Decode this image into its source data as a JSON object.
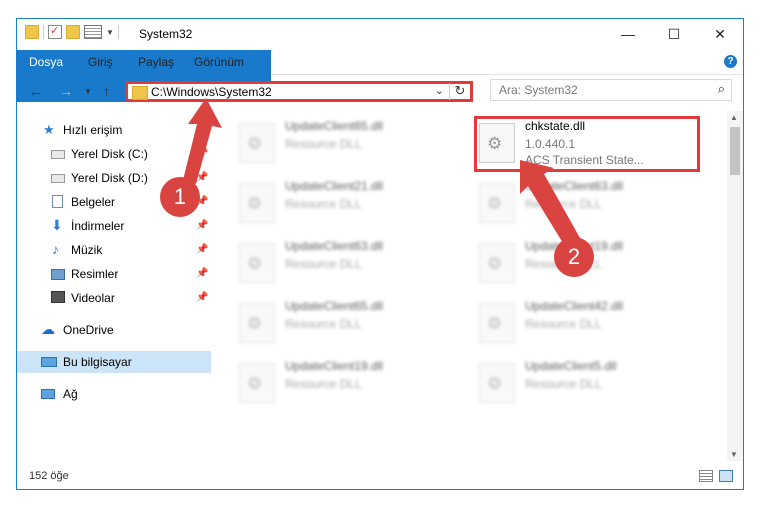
{
  "window": {
    "title": "System32"
  },
  "ribbon": {
    "tabs": [
      "Dosya",
      "Giriş",
      "Paylaş",
      "Görünüm"
    ]
  },
  "address": {
    "path": "C:\\Windows\\System32"
  },
  "search": {
    "placeholder": "Ara: System32"
  },
  "sidebar": {
    "quick_access": "Hızlı erişim",
    "items": [
      "Yerel Disk (C:)",
      "Yerel Disk (D:)",
      "Belgeler",
      "İndirmeler",
      "Müzik",
      "Resimler",
      "Videolar"
    ],
    "onedrive": "OneDrive",
    "this_pc": "Bu bilgisayar",
    "network": "Ağ"
  },
  "files": {
    "left": [
      {
        "name": "UpdateClient65.dll",
        "type": "Resource DLL"
      },
      {
        "name": "UpdateClient21.dll",
        "type": "Resource DLL"
      },
      {
        "name": "UpdateClient63.dll",
        "type": "Resource DLL"
      },
      {
        "name": "UpdateClient65.dll",
        "type": "Resource DLL"
      },
      {
        "name": "UpdateClient19.dll",
        "type": "Resource DLL"
      }
    ],
    "right": [
      {
        "name": "UpdateClient63.dll",
        "type": "Resource DLL"
      },
      {
        "name": "UpdateClient19.dll",
        "type": "Resource DLL"
      },
      {
        "name": "UpdateClient42.dll",
        "type": "Resource DLL"
      },
      {
        "name": "UpdateClient5.dll",
        "type": "Resource DLL"
      }
    ],
    "highlighted": {
      "name": "chkstate.dll",
      "version": "1.0.440.1",
      "description": "ACS Transient State..."
    }
  },
  "status": {
    "item_count": "152 öğe"
  },
  "badges": [
    "1",
    "2"
  ],
  "colors": {
    "accent": "#1979ca",
    "annotation": "#d94441",
    "selected": "#cce4f7"
  }
}
